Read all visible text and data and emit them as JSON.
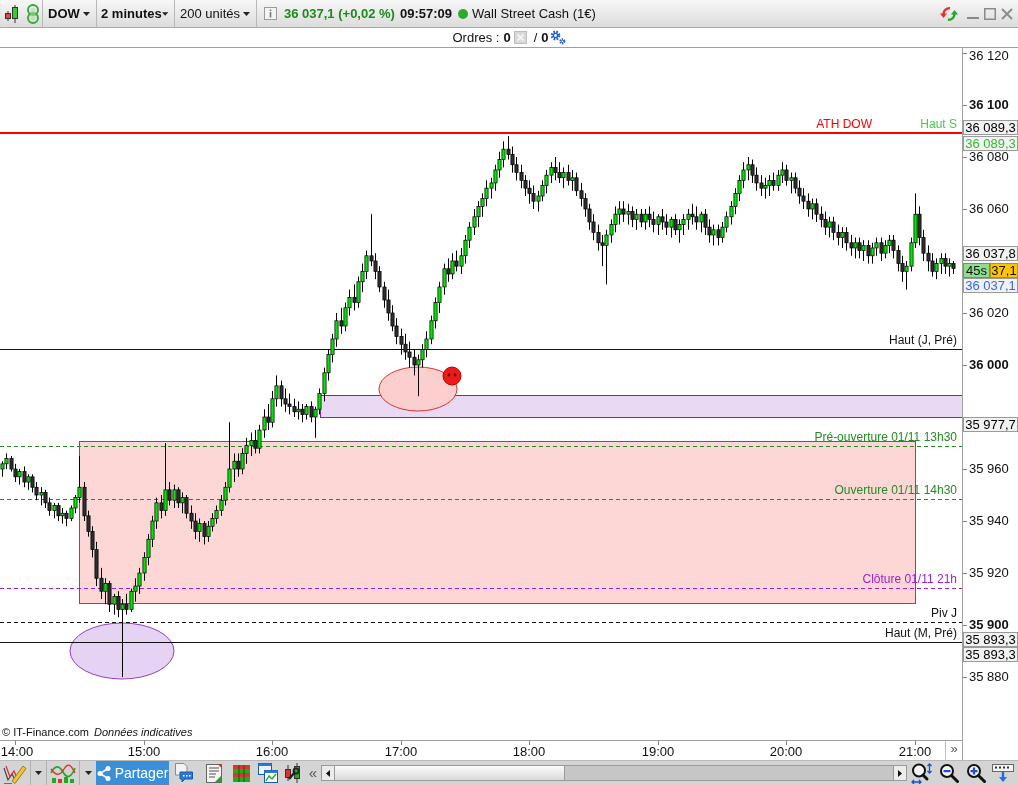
{
  "toolbar": {
    "symbol": "DOW",
    "period": "2 minutes",
    "quantity": "200 unités",
    "quote": "36 037,1 (+0,02 %)",
    "time": "09:57:09",
    "market_open": true,
    "market": "Wall Street Cash (1€)"
  },
  "orders": {
    "label": "Ordres :",
    "count": "0",
    "separator": "/",
    "pending": "0"
  },
  "chart": {
    "chart_data": {
      "type": "candlestick",
      "ylim": [
        35855.8,
        36121.9
      ],
      "yticks": [
        {
          "value": 36120,
          "label": "36 120"
        },
        {
          "value": 36100,
          "label": "36 100"
        },
        {
          "value": 36080,
          "label": "36 080"
        },
        {
          "value": 36060,
          "label": "36 060"
        },
        {
          "value": 36020,
          "label": "36 020"
        },
        {
          "value": 36000,
          "label": "36 000"
        },
        {
          "value": 35960,
          "label": "35 960"
        },
        {
          "value": 35940,
          "label": "35 940"
        },
        {
          "value": 35920,
          "label": "35 920"
        },
        {
          "value": 35900,
          "label": "35 900"
        },
        {
          "value": 35880,
          "label": "35 880"
        }
      ],
      "ref_lines": [
        {
          "axis": "y",
          "value": 36089.3,
          "label": "ATH DOW",
          "color": "#ff0000"
        },
        {
          "axis": "y",
          "value": 36006,
          "label": "Haut (J, Pré)",
          "color": "#111111"
        },
        {
          "axis": "y",
          "value": 35969,
          "label": "Pré-ouverture 01/11 13h30",
          "color": "#228b22"
        },
        {
          "axis": "y",
          "value": 35948.5,
          "label": "Ouverture 01/11 14h30",
          "color": "#228b22"
        },
        {
          "axis": "y",
          "value": 35914.2,
          "label": "Clôture 01/11 21h",
          "color": "#a020d0"
        },
        {
          "axis": "y",
          "value": 35901.2,
          "label": "Piv J",
          "color": "#111111"
        },
        {
          "axis": "y",
          "value": 35893.3,
          "label": "Haut (M, Pré)",
          "color": "#111111"
        }
      ],
      "bands": [
        {
          "axis": "y",
          "from": 35980,
          "to": 35988.5,
          "color": "#ead9f3"
        }
      ],
      "categories": [
        null,
        null,
        null,
        "14:00",
        null,
        null,
        null,
        null,
        null,
        null,
        null,
        null,
        null,
        null,
        null,
        null,
        null,
        null,
        null,
        null,
        null,
        null,
        null,
        null,
        null,
        null,
        null,
        null,
        null,
        null,
        null,
        null,
        null,
        "15:00",
        null,
        null,
        null,
        null,
        null,
        null,
        null,
        null,
        null,
        null,
        null,
        null,
        null,
        null,
        null,
        null,
        null,
        null,
        null,
        null,
        null,
        null,
        null,
        null,
        null,
        null,
        null,
        null,
        null,
        "16:00",
        null,
        null,
        null,
        null,
        null,
        null,
        null,
        null,
        null,
        null,
        null,
        null,
        null,
        null,
        null,
        null,
        null,
        null,
        null,
        null,
        null,
        null,
        null,
        null,
        null,
        null,
        null,
        null,
        null,
        "17:00",
        null,
        null,
        null,
        null,
        null,
        null,
        null,
        null,
        null,
        null,
        null,
        null,
        null,
        null,
        null,
        null,
        null,
        null,
        null,
        null,
        null,
        null,
        null,
        null,
        null,
        null,
        null,
        null,
        null,
        "18:00",
        null,
        null,
        null,
        null,
        null,
        null,
        null,
        null,
        null,
        null,
        null,
        null,
        null,
        null,
        null,
        null,
        null,
        null,
        null,
        null,
        null,
        null,
        null,
        null,
        null,
        null,
        null,
        null,
        null,
        "19:00",
        null,
        null,
        null,
        null,
        null,
        null,
        null,
        null,
        null,
        null,
        null,
        null,
        null,
        null,
        null,
        null,
        null,
        null,
        null,
        null,
        null,
        null,
        null,
        null,
        null,
        null,
        null,
        null,
        null,
        "20:00",
        null,
        null,
        null,
        null,
        null,
        null,
        null,
        null,
        null,
        null,
        null,
        null,
        null,
        null,
        null,
        null,
        null,
        null,
        null,
        null,
        null,
        null,
        null,
        null,
        null,
        null,
        null,
        null,
        null,
        "21:00",
        null,
        null,
        null,
        null,
        null,
        null,
        null,
        null,
        null
      ],
      "ohlc": [
        [
          35960,
          35963,
          35957,
          35962
        ],
        [
          35962,
          35966,
          35960,
          35964
        ],
        [
          35964,
          35965,
          35959,
          35960
        ],
        [
          35960,
          35962,
          35955,
          35957
        ],
        [
          35957,
          35960,
          35954,
          35959
        ],
        [
          35959,
          35961,
          35953,
          35955
        ],
        [
          35955,
          35958,
          35952,
          35957
        ],
        [
          35957,
          35958,
          35951,
          35953
        ],
        [
          35953,
          35955,
          35948,
          35950
        ],
        [
          35950,
          35953,
          35946,
          35951
        ],
        [
          35951,
          35952,
          35945,
          35947
        ],
        [
          35947,
          35949,
          35942,
          35944
        ],
        [
          35944,
          35947,
          35941,
          35946
        ],
        [
          35946,
          35947,
          35940,
          35942
        ],
        [
          35942,
          35945,
          35939,
          35943
        ],
        [
          35943,
          35944,
          35938,
          35941
        ],
        [
          35941,
          35946,
          35940,
          35945
        ],
        [
          35945,
          35950,
          35943,
          35949
        ],
        [
          35949,
          35965,
          35947,
          35953
        ],
        [
          35953,
          35955,
          35940,
          35942
        ],
        [
          35942,
          35944,
          35934,
          35936
        ],
        [
          35936,
          35938,
          35926,
          35929
        ],
        [
          35929,
          35932,
          35915,
          35918
        ],
        [
          35918,
          35922,
          35910,
          35913
        ],
        [
          35913,
          35918,
          35908,
          35916
        ],
        [
          35916,
          35917,
          35905,
          35908
        ],
        [
          35908,
          35912,
          35904,
          35911
        ],
        [
          35911,
          35913,
          35903,
          35906
        ],
        [
          35906,
          35910,
          35880,
          35908
        ],
        [
          35908,
          35912,
          35904,
          35906
        ],
        [
          35906,
          35914,
          35905,
          35913
        ],
        [
          35913,
          35918,
          35909,
          35915
        ],
        [
          35915,
          35922,
          35912,
          35920
        ],
        [
          35920,
          35928,
          35917,
          35926
        ],
        [
          35926,
          35935,
          35923,
          35933
        ],
        [
          35933,
          35942,
          35930,
          35940
        ],
        [
          35940,
          35949,
          35937,
          35947
        ],
        [
          35947,
          35950,
          35941,
          35944
        ],
        [
          35944,
          35970,
          35942,
          35952
        ],
        [
          35952,
          35955,
          35946,
          35948
        ],
        [
          35948,
          35954,
          35945,
          35952
        ],
        [
          35952,
          35953,
          35945,
          35947
        ],
        [
          35947,
          35951,
          35943,
          35949
        ],
        [
          35949,
          35950,
          35941,
          35943
        ],
        [
          35943,
          35946,
          35937,
          35940
        ],
        [
          35940,
          35943,
          35933,
          35936
        ],
        [
          35936,
          35941,
          35932,
          35939
        ],
        [
          35939,
          35940,
          35931,
          35934
        ],
        [
          35934,
          35940,
          35932,
          35938
        ],
        [
          35938,
          35943,
          35936,
          35941
        ],
        [
          35941,
          35946,
          35939,
          35944
        ],
        [
          35944,
          35950,
          35942,
          35948
        ],
        [
          35948,
          35955,
          35946,
          35953
        ],
        [
          35953,
          35978,
          35951,
          35960
        ],
        [
          35960,
          35966,
          35955,
          35963
        ],
        [
          35963,
          35966,
          35957,
          35960
        ],
        [
          35960,
          35968,
          35958,
          35966
        ],
        [
          35966,
          35972,
          35962,
          35969
        ],
        [
          35969,
          35974,
          35965,
          35971
        ],
        [
          35971,
          35975,
          35966,
          35968
        ],
        [
          35968,
          35977,
          35966,
          35975
        ],
        [
          35975,
          35983,
          35972,
          35980
        ],
        [
          35980,
          35985,
          35975,
          35978
        ],
        [
          35978,
          35990,
          35976,
          35987
        ],
        [
          35987,
          35996,
          35984,
          35992
        ],
        [
          35992,
          35994,
          35984,
          35987
        ],
        [
          35987,
          35991,
          35982,
          35985
        ],
        [
          35985,
          35989,
          35981,
          35984
        ],
        [
          35984,
          35987,
          35980,
          35982
        ],
        [
          35982,
          35986,
          35979,
          35983
        ],
        [
          35983,
          35985,
          35978,
          35981
        ],
        [
          35981,
          35985,
          35979,
          35984
        ],
        [
          35984,
          35986,
          35978,
          35980
        ],
        [
          35980,
          35984,
          35972,
          35983
        ],
        [
          35983,
          35991,
          35981,
          35989
        ],
        [
          35989,
          35999,
          35986,
          35997
        ],
        [
          35997,
          36006,
          35994,
          36004
        ],
        [
          36004,
          36012,
          36001,
          36010
        ],
        [
          36010,
          36020,
          36007,
          36017
        ],
        [
          36017,
          36022,
          36012,
          36015
        ],
        [
          36015,
          36024,
          36013,
          36022
        ],
        [
          36022,
          36029,
          36019,
          36026
        ],
        [
          36026,
          36031,
          36021,
          36024
        ],
        [
          36024,
          36034,
          36022,
          36032
        ],
        [
          36032,
          36039,
          36028,
          36036
        ],
        [
          36036,
          36044,
          36033,
          36042
        ],
        [
          36042,
          36058,
          36038,
          36040
        ],
        [
          36040,
          36043,
          36033,
          36036
        ],
        [
          36036,
          36038,
          36028,
          36030
        ],
        [
          36030,
          36032,
          36022,
          36025
        ],
        [
          36025,
          36029,
          36017,
          36020
        ],
        [
          36020,
          36023,
          36013,
          36015
        ],
        [
          36015,
          36018,
          36008,
          36011
        ],
        [
          36011,
          36014,
          36004,
          36008
        ],
        [
          36008,
          36012,
          36002,
          36005
        ],
        [
          36005,
          36009,
          35999,
          36003
        ],
        [
          36003,
          36006,
          35996,
          36000
        ],
        [
          36000,
          36004,
          35988,
          36002
        ],
        [
          36002,
          36008,
          35999,
          36006
        ],
        [
          36006,
          36013,
          36003,
          36010
        ],
        [
          36010,
          36019,
          36008,
          36017
        ],
        [
          36017,
          36026,
          36014,
          36024
        ],
        [
          36024,
          36032,
          36020,
          36030
        ],
        [
          36030,
          36039,
          36027,
          36037
        ],
        [
          36037,
          36041,
          36032,
          36035
        ],
        [
          36035,
          36043,
          36033,
          36040
        ],
        [
          36040,
          36044,
          36036,
          36038
        ],
        [
          36038,
          36045,
          36035,
          36042
        ],
        [
          36042,
          36050,
          36039,
          36048
        ],
        [
          36048,
          36055,
          36045,
          36053
        ],
        [
          36053,
          36060,
          36050,
          36057
        ],
        [
          36057,
          36063,
          36053,
          36061
        ],
        [
          36061,
          36066,
          36057,
          36064
        ],
        [
          36064,
          36071,
          36061,
          36068
        ],
        [
          36068,
          36072,
          36064,
          36070
        ],
        [
          36070,
          36077,
          36067,
          36075
        ],
        [
          36075,
          36082,
          36072,
          36079
        ],
        [
          36079,
          36086,
          36076,
          36083
        ],
        [
          36083,
          36088,
          36079,
          36081
        ],
        [
          36081,
          36084,
          36074,
          36077
        ],
        [
          36077,
          36080,
          36071,
          36074
        ],
        [
          36074,
          36077,
          36068,
          36071
        ],
        [
          36071,
          36073,
          36065,
          36068
        ],
        [
          36068,
          36071,
          36062,
          36066
        ],
        [
          36066,
          36069,
          36060,
          36063
        ],
        [
          36063,
          36067,
          36059,
          36065
        ],
        [
          36065,
          36071,
          36063,
          36069
        ],
        [
          36069,
          36075,
          36066,
          36073
        ],
        [
          36073,
          36078,
          36070,
          36076
        ],
        [
          36076,
          36080,
          36071,
          36074
        ],
        [
          36074,
          36078,
          36070,
          36072
        ],
        [
          36072,
          36076,
          36068,
          36074
        ],
        [
          36074,
          36077,
          36069,
          36071
        ],
        [
          36071,
          36075,
          36067,
          36072
        ],
        [
          36072,
          36074,
          36065,
          36067
        ],
        [
          36067,
          36070,
          36061,
          36064
        ],
        [
          36064,
          36066,
          36057,
          36060
        ],
        [
          36060,
          36062,
          36052,
          36055
        ],
        [
          36055,
          36058,
          36048,
          36051
        ],
        [
          36051,
          36054,
          36044,
          36047
        ],
        [
          36047,
          36050,
          36038,
          36046
        ],
        [
          36046,
          36052,
          36031,
          36050
        ],
        [
          36050,
          36056,
          36047,
          36054
        ],
        [
          36054,
          36061,
          36051,
          36058
        ],
        [
          36058,
          36063,
          36054,
          36060
        ],
        [
          36060,
          36063,
          36055,
          36058
        ],
        [
          36058,
          36062,
          36054,
          36059
        ],
        [
          36059,
          36061,
          36053,
          36056
        ],
        [
          36056,
          36060,
          36052,
          36058
        ],
        [
          36058,
          36060,
          36053,
          36055
        ],
        [
          36055,
          36060,
          36052,
          36058
        ],
        [
          36058,
          36061,
          36053,
          36056
        ],
        [
          36056,
          36059,
          36051,
          36054
        ],
        [
          36054,
          36058,
          36050,
          36057
        ],
        [
          36057,
          36060,
          36052,
          36055
        ],
        [
          36055,
          36058,
          36050,
          36053
        ],
        [
          36053,
          36057,
          36049,
          36056
        ],
        [
          36056,
          36058,
          36050,
          36052
        ],
        [
          36052,
          36056,
          36047,
          36054
        ],
        [
          36054,
          36058,
          36050,
          36056
        ],
        [
          36056,
          36060,
          36052,
          36058
        ],
        [
          36058,
          36062,
          36054,
          36057
        ],
        [
          36057,
          36061,
          36052,
          36055
        ],
        [
          36055,
          36059,
          36051,
          36058
        ],
        [
          36058,
          36060,
          36050,
          36053
        ],
        [
          36053,
          36056,
          36047,
          36050
        ],
        [
          36050,
          36054,
          36046,
          36052
        ],
        [
          36052,
          36054,
          36046,
          36049
        ],
        [
          36049,
          36055,
          36047,
          36053
        ],
        [
          36053,
          36059,
          36051,
          36057
        ],
        [
          36057,
          36063,
          36054,
          36061
        ],
        [
          36061,
          36068,
          36058,
          36066
        ],
        [
          36066,
          36073,
          36063,
          36071
        ],
        [
          36071,
          36078,
          36068,
          36075
        ],
        [
          36075,
          36080,
          36071,
          36077
        ],
        [
          36077,
          36079,
          36070,
          36073
        ],
        [
          36073,
          36076,
          36067,
          36070
        ],
        [
          36070,
          36073,
          36065,
          36068
        ],
        [
          36068,
          36072,
          36064,
          36069
        ],
        [
          36069,
          36073,
          36065,
          36071
        ],
        [
          36071,
          36074,
          36067,
          36069
        ],
        [
          36069,
          36075,
          36067,
          36073
        ],
        [
          36073,
          36078,
          36070,
          36075
        ],
        [
          36075,
          36077,
          36069,
          36071
        ],
        [
          36071,
          36074,
          36066,
          36072
        ],
        [
          36072,
          36074,
          36066,
          36068
        ],
        [
          36068,
          36071,
          36062,
          36065
        ],
        [
          36065,
          36068,
          36060,
          36063
        ],
        [
          36063,
          36066,
          36057,
          36060
        ],
        [
          36060,
          36064,
          36056,
          36062
        ],
        [
          36062,
          36064,
          36055,
          36058
        ],
        [
          36058,
          36061,
          36053,
          36056
        ],
        [
          36056,
          36059,
          36050,
          36053
        ],
        [
          36053,
          36057,
          36049,
          36055
        ],
        [
          36055,
          36057,
          36048,
          36051
        ],
        [
          36051,
          36054,
          36046,
          36049
        ],
        [
          36049,
          36053,
          36045,
          36051
        ],
        [
          36051,
          36053,
          36044,
          36047
        ],
        [
          36047,
          36050,
          36042,
          36045
        ],
        [
          36045,
          36049,
          36041,
          36047
        ],
        [
          36047,
          36049,
          36041,
          36044
        ],
        [
          36044,
          36048,
          36040,
          36046
        ],
        [
          36046,
          36048,
          36039,
          36042
        ],
        [
          36042,
          36047,
          36039,
          36045
        ],
        [
          36045,
          36049,
          36042,
          36047
        ],
        [
          36047,
          36049,
          36040,
          36043
        ],
        [
          36043,
          36048,
          36041,
          36046
        ],
        [
          36046,
          36050,
          36043,
          36048
        ],
        [
          36048,
          36050,
          36041,
          36044
        ],
        [
          36044,
          36046,
          36036,
          36039
        ],
        [
          36039,
          36042,
          36032,
          36036
        ],
        [
          36036,
          36040,
          36029,
          36038
        ],
        [
          36038,
          36049,
          36036,
          36047
        ],
        [
          36047,
          36066,
          36045,
          36058
        ],
        [
          36058,
          36061,
          36046,
          36049
        ],
        [
          36049,
          36052,
          36040,
          36043
        ],
        [
          36043,
          36046,
          36036,
          36040
        ],
        [
          36040,
          36043,
          36034,
          36036
        ],
        [
          36036,
          36041,
          36033,
          36039
        ],
        [
          36039,
          36043,
          36035,
          36041
        ],
        [
          36041,
          36043,
          36035,
          36038
        ],
        [
          36038,
          36041,
          36034,
          36039
        ],
        [
          36039,
          36040,
          36035,
          36037.1
        ]
      ]
    },
    "side_labels": [
      {
        "text": "Haut S",
        "color": "#44cc44"
      }
    ],
    "price_tags": [
      {
        "text": "36 089,3",
        "color": "#000000"
      },
      {
        "text": "36 089,3",
        "color": "#33bb33"
      },
      {
        "text": "36 037,8",
        "color": "#000000"
      },
      {
        "text": "36 037,1",
        "color": "#3366ff"
      },
      {
        "text": "35 977,7",
        "color": "#000000"
      },
      {
        "text": "35 893,3",
        "color": "#000000"
      },
      {
        "text": "35 893,3",
        "color": "#000000"
      }
    ],
    "live_tag": {
      "countdown": "45s",
      "last": "37,1"
    },
    "credit": "© IT-Finance.com",
    "disclaimer": "Données indicatives",
    "scroll_end": "»"
  },
  "bottom_toolbar": {
    "share": "Partager",
    "scroll_back": "«"
  }
}
